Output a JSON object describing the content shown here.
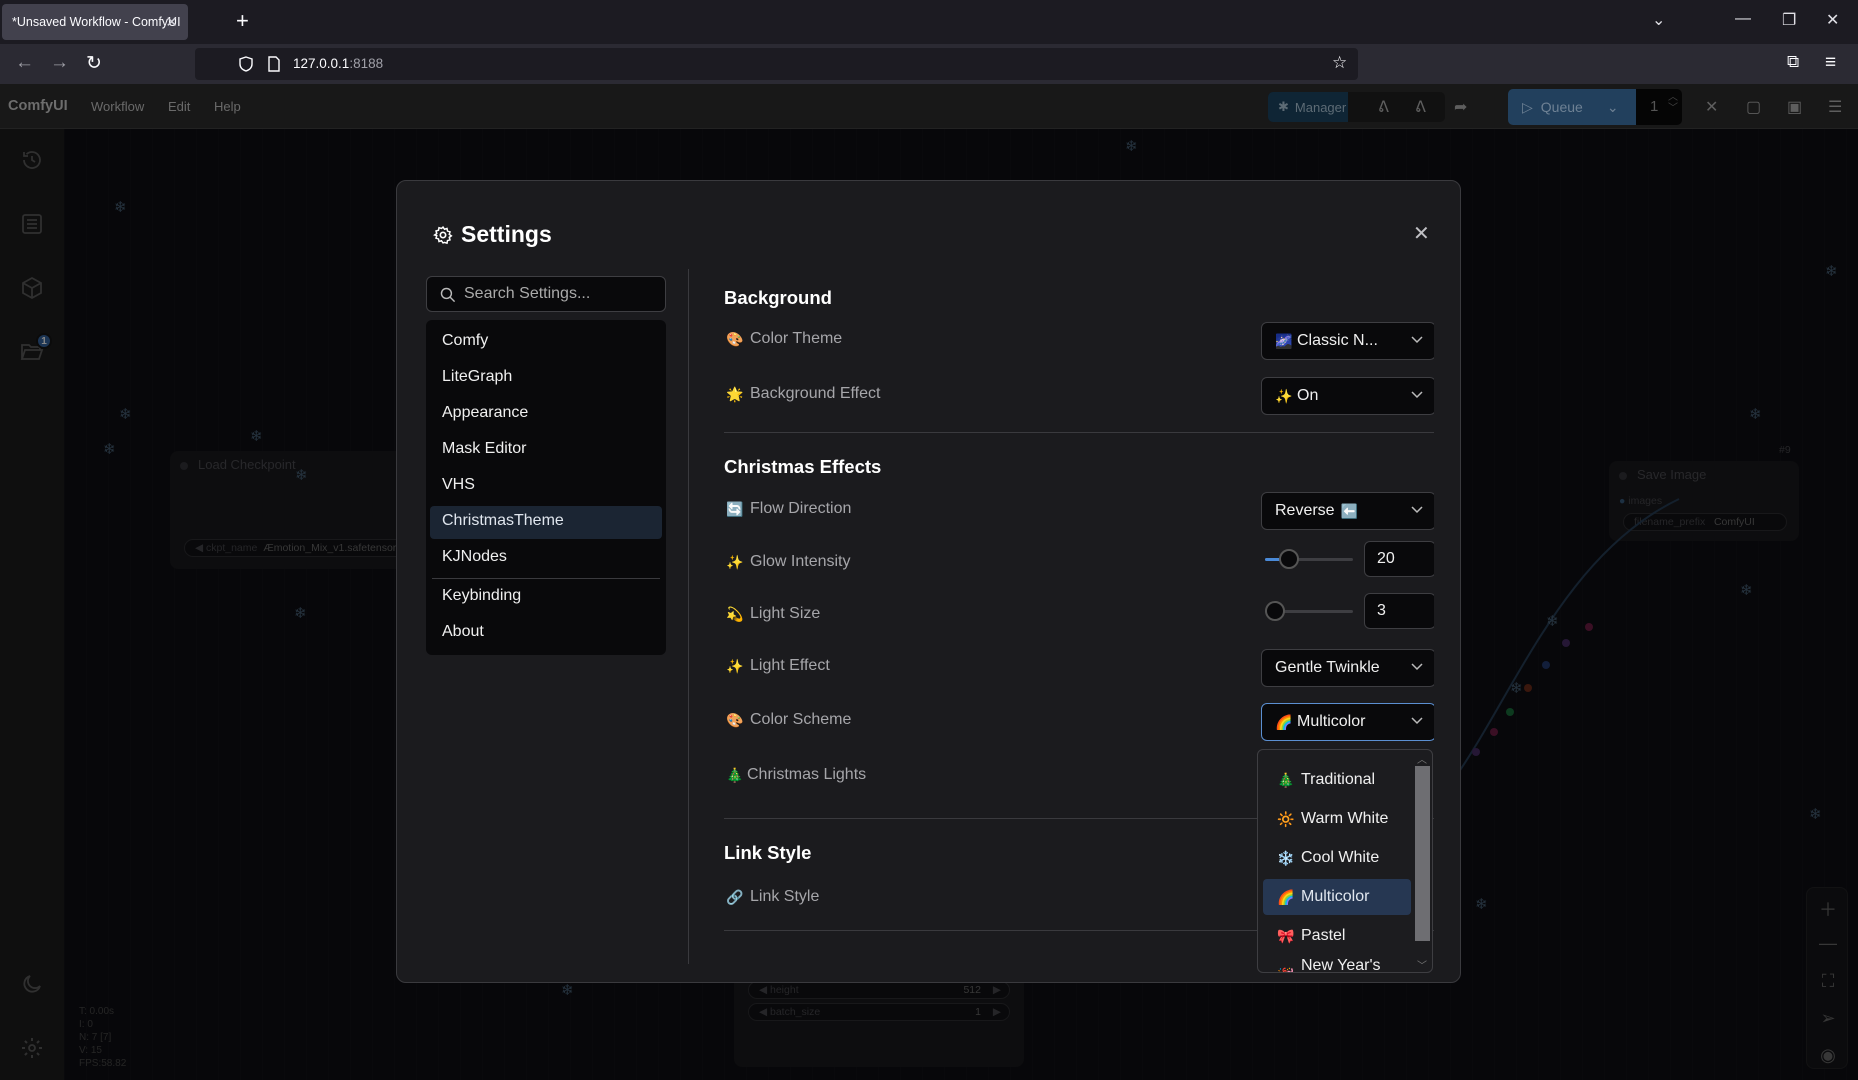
{
  "browser": {
    "tab_title": "*Unsaved Workflow - ComfyUI",
    "url_host": "127.0.0.1",
    "url_port": ":8188"
  },
  "topmenu": {
    "brand": "ComfyUI",
    "items": [
      "Workflow",
      "Edit",
      "Help"
    ],
    "manager_label": "Manager",
    "queue_label": "Queue",
    "queue_count": "1"
  },
  "sidebar": {
    "badge_count": "1"
  },
  "canvas": {
    "load_checkpoint": {
      "title": "Load Checkpoint",
      "widget_name": "ckpt_name",
      "widget_value": "Æmotion_Mix_v1.safetensors"
    },
    "save_image": {
      "id": "#9",
      "title": "Save Image",
      "input": "images",
      "widget_name": "filename_prefix",
      "widget_value": "ComfyUI"
    },
    "latent": {
      "height_name": "height",
      "height_value": "512",
      "batch_name": "batch_size",
      "batch_value": "1"
    },
    "stats": [
      "T: 0.00s",
      "I: 0",
      "N: 7 [7]",
      "V: 15",
      "FPS:58.82"
    ]
  },
  "settings": {
    "title": "Settings",
    "search_placeholder": "Search Settings...",
    "categories": [
      "Comfy",
      "LiteGraph",
      "Appearance",
      "Mask Editor",
      "VHS",
      "ChristmasTheme",
      "KJNodes",
      "Keybinding",
      "About"
    ],
    "active_category": "ChristmasTheme",
    "sections": {
      "background": {
        "title": "Background",
        "color_theme": {
          "icon": "🎨",
          "label": "Color Theme",
          "value_icon": "🌌",
          "value": "Classic N..."
        },
        "background_effect": {
          "icon": "🌟",
          "label": "Background Effect",
          "value_icon": "✨",
          "value": "On"
        }
      },
      "christmas": {
        "title": "Christmas Effects",
        "flow_direction": {
          "icon": "🔄",
          "label": "Flow Direction",
          "value": "Reverse",
          "value_icon": "⬅️"
        },
        "glow_intensity": {
          "icon": "✨",
          "label": "Glow Intensity",
          "value": "20",
          "fraction": 0.2
        },
        "light_size": {
          "icon": "💫",
          "label": "Light Size",
          "value": "3",
          "fraction": 0.0
        },
        "light_effect": {
          "icon": "✨",
          "label": "Light Effect",
          "value": "Gentle Twinkle"
        },
        "color_scheme": {
          "icon": "🎨",
          "label": "Color Scheme",
          "value_icon": "🌈",
          "value": "Multicolor"
        },
        "christmas_lights": {
          "icon": "🎄",
          "label": "Christmas Lights"
        }
      },
      "link": {
        "title": "Link Style",
        "link_style": {
          "icon": "🔗",
          "label": "Link Style"
        }
      }
    },
    "color_scheme_options": [
      {
        "icon": "🎄",
        "label": "Traditional"
      },
      {
        "icon": "🔆",
        "label": "Warm White"
      },
      {
        "icon": "❄️",
        "label": "Cool White"
      },
      {
        "icon": "🌈",
        "label": "Multicolor",
        "selected": true
      },
      {
        "icon": "🎀",
        "label": "Pastel"
      },
      {
        "icon": "🎉",
        "label": "New Year's Eve"
      }
    ]
  }
}
